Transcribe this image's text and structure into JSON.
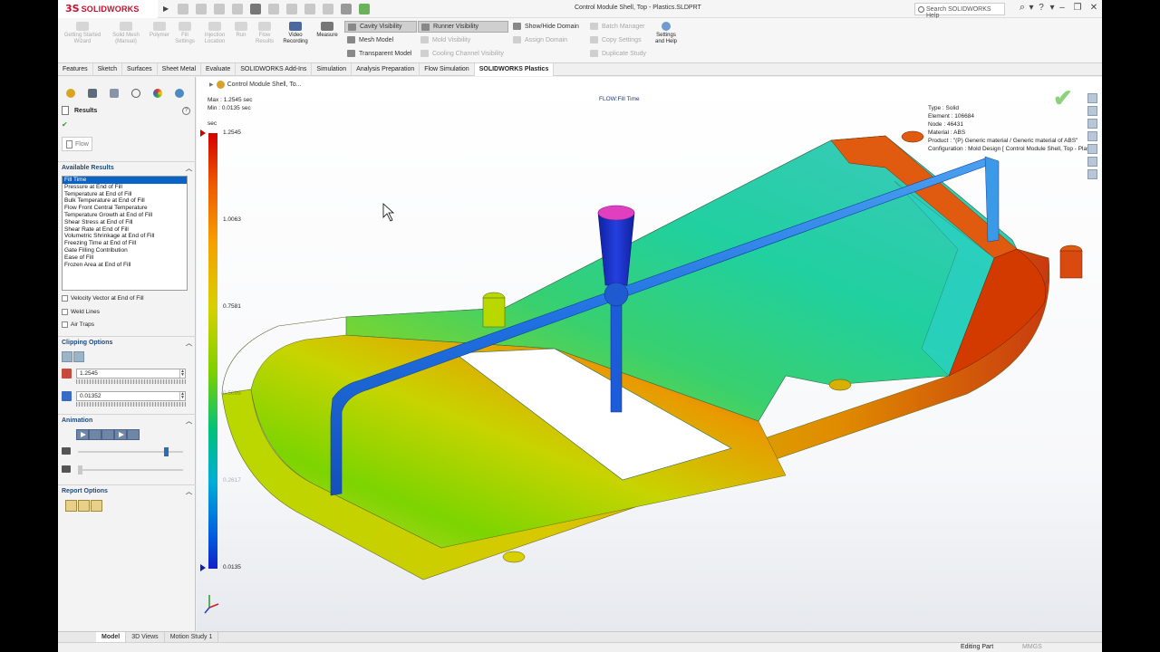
{
  "app": {
    "title": "Control Module Shell, Top - Plastics.SLDPRT",
    "logo_text": "SOLIDWORKS",
    "search_placeholder": "Search SOLIDWORKS Help"
  },
  "command_manager": {
    "buttons": [
      {
        "label": "Getting Started Wizard",
        "enabled": false
      },
      {
        "label": "Solid Mesh (Manual)",
        "enabled": false
      },
      {
        "label": "Polymer",
        "enabled": false
      },
      {
        "label": "Fill Settings",
        "enabled": false
      },
      {
        "label": "Injection Location",
        "enabled": false
      },
      {
        "label": "Run",
        "enabled": false
      },
      {
        "label": "Flow Results",
        "enabled": false
      },
      {
        "label": "Video Recording",
        "enabled": true
      },
      {
        "label": "Measure",
        "enabled": true
      }
    ],
    "rows": [
      {
        "label": "Cavity Visibility",
        "state": "selected"
      },
      {
        "label": "Runner Visibility",
        "state": "selected"
      },
      {
        "label": "Show/Hide Domain",
        "state": "normal"
      },
      {
        "label": "Batch Manager",
        "state": "disabled"
      },
      {
        "label": "Mesh Model",
        "state": "normal"
      },
      {
        "label": "Mold Visibility",
        "state": "disabled"
      },
      {
        "label": "Assign Domain",
        "state": "disabled"
      },
      {
        "label": "Copy Settings",
        "state": "disabled"
      },
      {
        "label": "Transparent Model",
        "state": "normal"
      },
      {
        "label": "Cooling Channel Visibility",
        "state": "disabled"
      },
      {
        "label": "Duplicate Study",
        "state": "disabled"
      }
    ],
    "settings_label": "Settings and Help"
  },
  "tabs": [
    "Features",
    "Sketch",
    "Surfaces",
    "Sheet Metal",
    "Evaluate",
    "SOLIDWORKS Add-Ins",
    "Simulation",
    "Analysis Preparation",
    "Flow Simulation",
    "SOLIDWORKS Plastics"
  ],
  "active_tab": "SOLIDWORKS Plastics",
  "panel": {
    "title": "Results",
    "sub_tab": "Flow",
    "available_results_header": "Available Results",
    "results": [
      "Fill Time",
      "Pressure at End of Fill",
      "Temperature at End of Fill",
      "Bulk Temperature at End of Fill",
      "Flow Front Central Temperature",
      "Temperature Growth at End of Fill",
      "Shear Stress at End of Fill",
      "Shear Rate at End of Fill",
      "Volumetric Shrinkage at End of Fill",
      "Freezing Time at End of Fill",
      "Gate Filling Contribution",
      "Ease of Fill",
      "Frozen Area at End of Fill"
    ],
    "selected_result": "Fill Time",
    "checkboxes": [
      "Velocity Vector at End of Fill",
      "Weld Lines",
      "Air Traps"
    ],
    "clipping_header": "Clipping Options",
    "clip_max": "1.2545",
    "clip_min": "0.01352",
    "animation_header": "Animation",
    "animation_speed_fraction": 0.82,
    "report_header": "Report Options"
  },
  "viewport": {
    "feature_node": "Control Module Shell, To...",
    "max_line": "Max : 1.2545 sec",
    "min_line": "Min : 0.0135 sec",
    "plot_title": "FLOW:Fill Time",
    "info_lines": [
      "Type : Solid",
      "Element : 106684",
      "Node : 46431",
      "Material : ABS",
      "Product : \"(P) Generic material / Generic material of ABS\"",
      "Configuration : Mold Design [ Control Module Shell, Top - Plasti"
    ],
    "legend": {
      "unit": "sec",
      "ticks": [
        "1.2545",
        "1.0063",
        "0.7581",
        "0.5099",
        "0.2617",
        "0.0135"
      ]
    }
  },
  "bottom_tabs": [
    "Model",
    "3D Views",
    "Motion Study 1"
  ],
  "active_bottom_tab": "Model",
  "status": {
    "mode": "Editing Part",
    "units": "MMGS"
  },
  "colors": {
    "brand": "#c8102e",
    "selection": "#0a64c8",
    "legend_max": "#d40000",
    "legend_min": "#1020c8"
  }
}
